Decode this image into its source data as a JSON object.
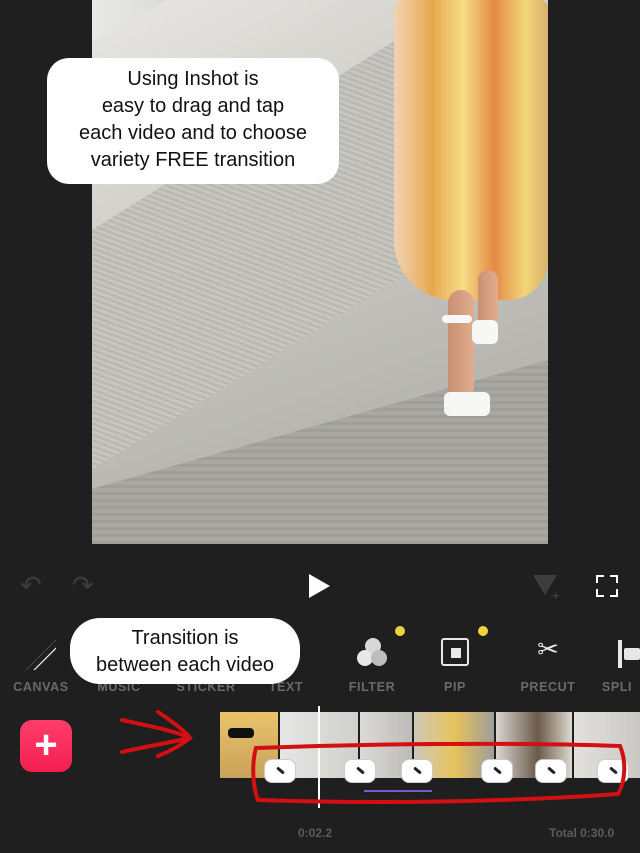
{
  "callouts": {
    "top": "Using Inshot is\neasy to drag and tap\neach video and to choose\nvariety FREE  transition",
    "transition": "Transition is\nbetween each video"
  },
  "toolbar": {
    "items": [
      {
        "label": "CANVAS",
        "icon": "canvas-icon"
      },
      {
        "label": "MUSIC",
        "icon": "music-icon"
      },
      {
        "label": "STICKER",
        "icon": "sticker-icon"
      },
      {
        "label": "TEXT",
        "icon": "text-icon"
      },
      {
        "label": "FILTER",
        "icon": "filter-icon",
        "new_dot": true
      },
      {
        "label": "PIP",
        "icon": "pip-icon",
        "new_dot": true
      },
      {
        "label": "PRECUT",
        "icon": "scissors-icon"
      },
      {
        "label": "SPLI",
        "icon": "split-icon"
      }
    ]
  },
  "timeline": {
    "current_time": "0:02.2",
    "total": "Total 0:30.0"
  },
  "colors": {
    "add_button": "#f6285a",
    "new_dot": "#f0d23b",
    "annotation": "#d40f12"
  }
}
